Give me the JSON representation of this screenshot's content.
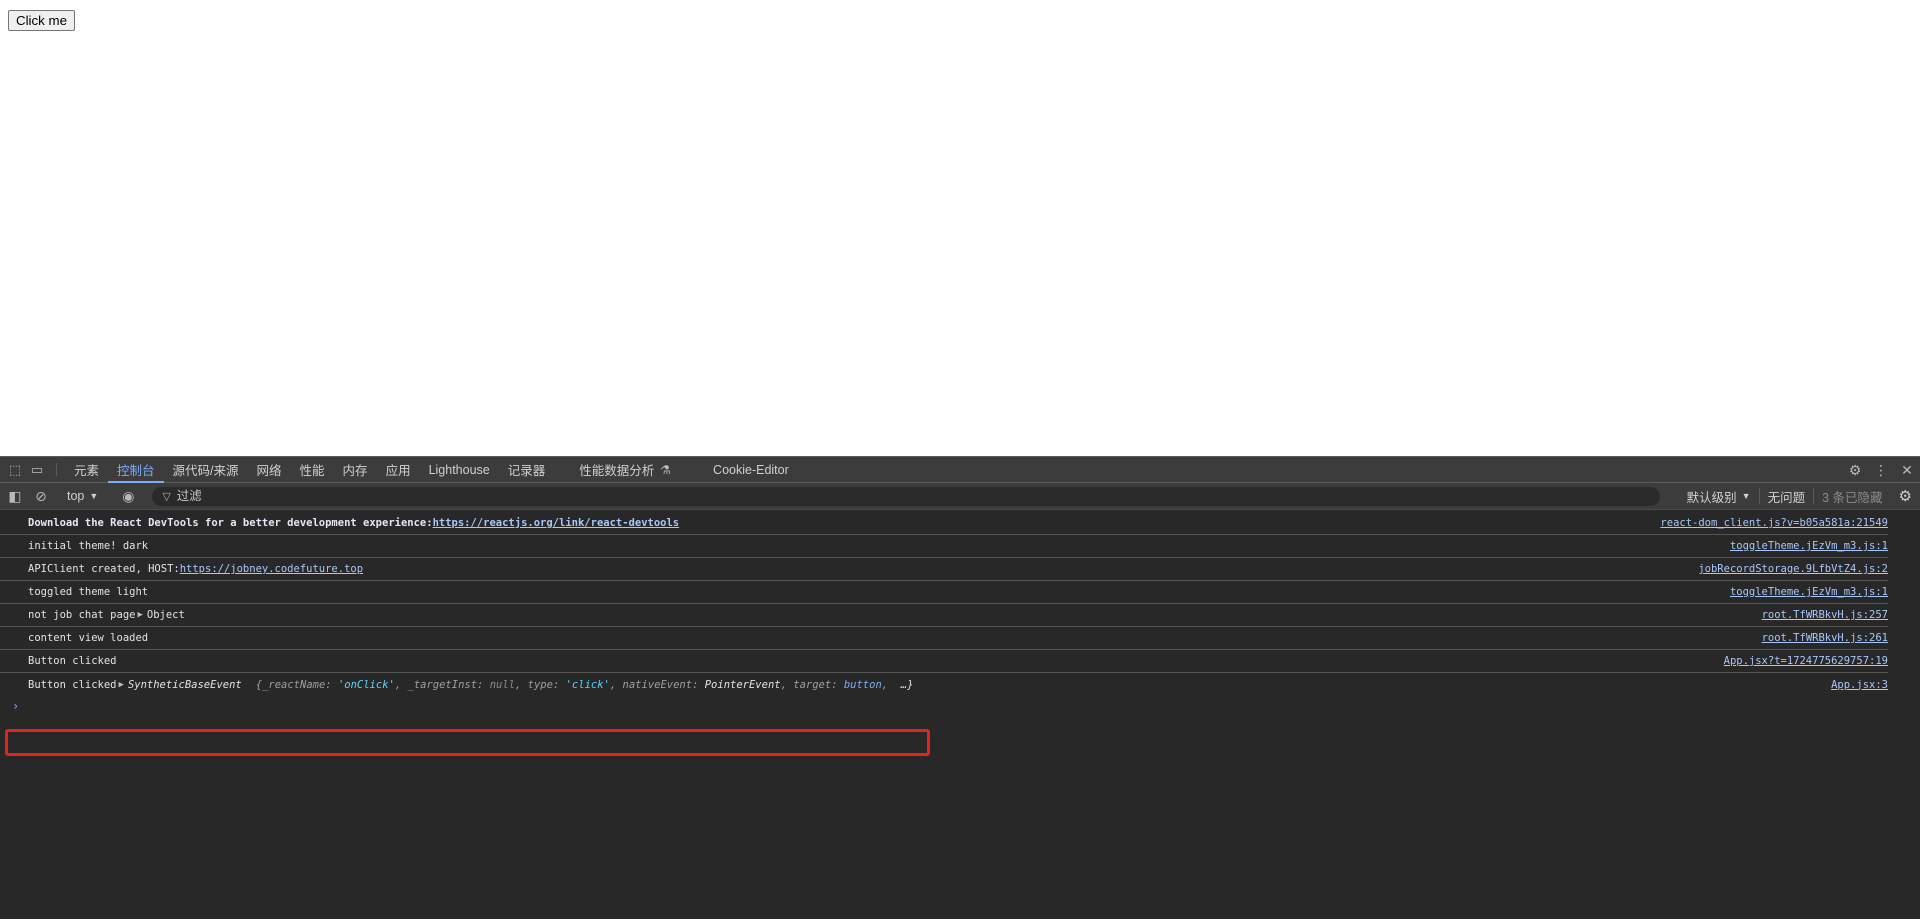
{
  "page": {
    "button_label": "Click me"
  },
  "devtools": {
    "tabs": [
      {
        "label": "元素",
        "active": false
      },
      {
        "label": "控制台",
        "active": true
      },
      {
        "label": "源代码/来源",
        "active": false
      },
      {
        "label": "网络",
        "active": false
      },
      {
        "label": "性能",
        "active": false
      },
      {
        "label": "内存",
        "active": false
      },
      {
        "label": "应用",
        "active": false
      },
      {
        "label": "Lighthouse",
        "active": false
      },
      {
        "label": "记录器",
        "active": false
      },
      {
        "label": "性能数据分析",
        "active": false
      },
      {
        "label": "Cookie-Editor",
        "active": false
      }
    ],
    "toolbar_icons": {
      "inspect": "inspect-element-icon",
      "device": "device-toolbar-icon",
      "settings": "gear-icon",
      "more": "kebab-menu-icon",
      "close": "close-icon"
    },
    "filterbar": {
      "context": "top",
      "filter_placeholder": "过滤",
      "log_level": "默认级别",
      "issues": "无问题",
      "hidden_count": "3 条已隐藏"
    },
    "console": {
      "rows": [
        {
          "text": "Download the React DevTools for a better development experience: ",
          "link": "https://reactjs.org/link/react-devtools",
          "source": "react-dom_client.js?v=b05a581a:21549",
          "bold": true
        },
        {
          "text": "initial theme! dark",
          "source": "toggleTheme.jEzVm_m3.js:1"
        },
        {
          "text": "APIClient created, HOST: ",
          "link": "https://jobney.codefuture.top",
          "source": "jobRecordStorage.9LfbVtZ4.js:2"
        },
        {
          "text": "toggled theme light",
          "source": "toggleTheme.jEzVm_m3.js:1"
        },
        {
          "text": "not job chat page ",
          "object": "Object",
          "source": "root.TfWRBkvH.js:257"
        },
        {
          "text": "content view loaded",
          "source": "root.TfWRBkvH.js:261"
        },
        {
          "text": "Button clicked",
          "source": "App.jsx?t=1724775629757:19"
        },
        {
          "text": "Button clicked ",
          "object_class": "SyntheticBaseEvent",
          "preview": {
            "open": "{",
            "k1": "_reactName",
            "v1": "'onClick'",
            "k2": "_targetInst",
            "v2": "null",
            "k3": "type",
            "v3": "'click'",
            "k4": "nativeEvent",
            "v4": "PointerEvent",
            "k5": "target",
            "v5": "button",
            "ellipsis": "…}"
          },
          "source": "App.jsx:3",
          "highlighted": true
        }
      ],
      "prompt": "›"
    },
    "highlight_color": "#e5221c",
    "accent_color": "#7cacf8"
  }
}
